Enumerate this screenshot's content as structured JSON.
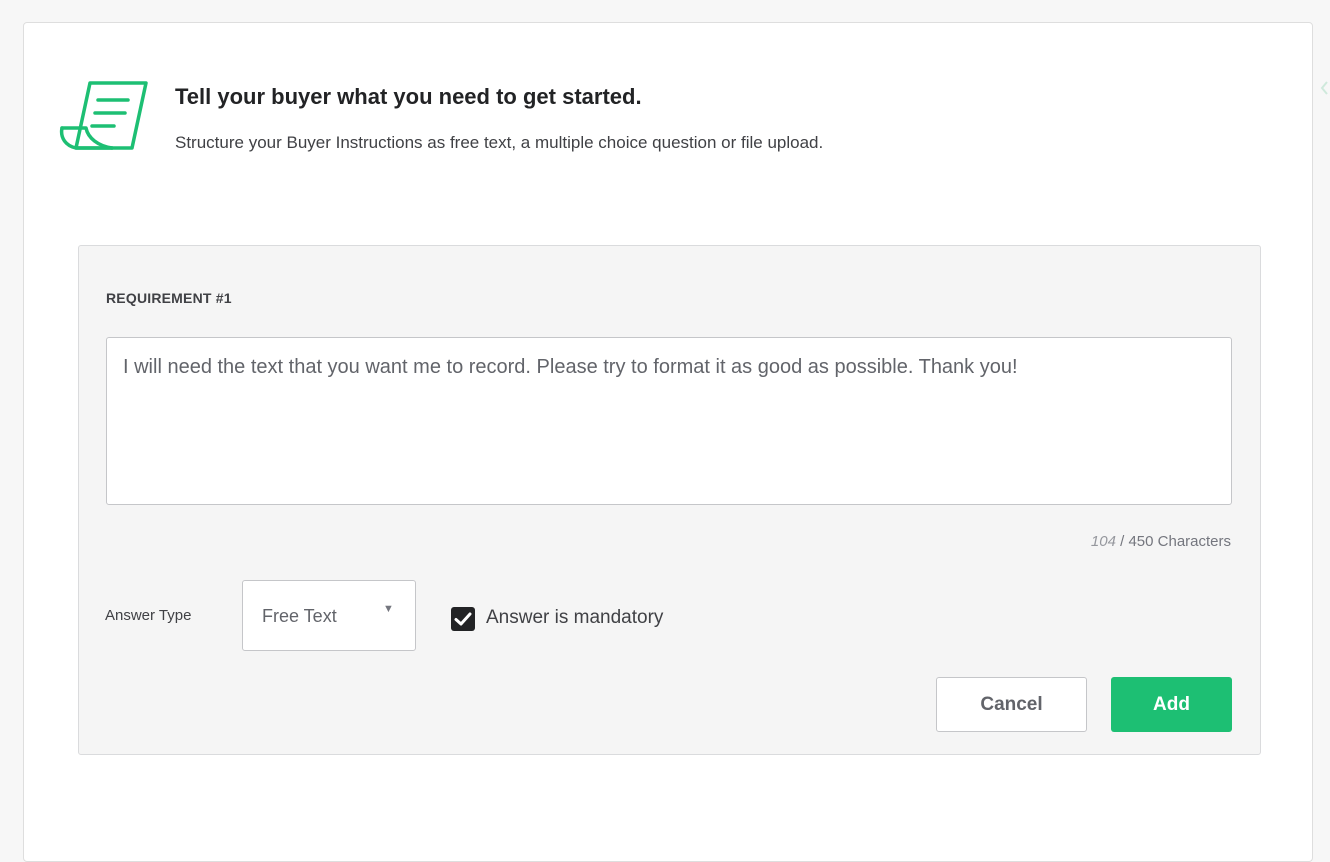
{
  "header": {
    "title": "Tell your buyer what you need to get started.",
    "subtitle": "Structure your Buyer Instructions as free text, a multiple choice question or file upload.",
    "icon": "document-scroll-icon"
  },
  "requirement": {
    "label": "REQUIREMENT #1",
    "text": "I will need the text that you want me to record. Please try to format it as good as possible. Thank you!",
    "char_count": "104",
    "char_limit_text": "/ 450 Characters"
  },
  "answer": {
    "type_label": "Answer Type",
    "type_value": "Free Text",
    "mandatory_label": "Answer is mandatory",
    "mandatory_checked": true
  },
  "buttons": {
    "cancel": "Cancel",
    "add": "Add"
  },
  "colors": {
    "accent": "#1dbf73",
    "checkbox": "#222325"
  }
}
